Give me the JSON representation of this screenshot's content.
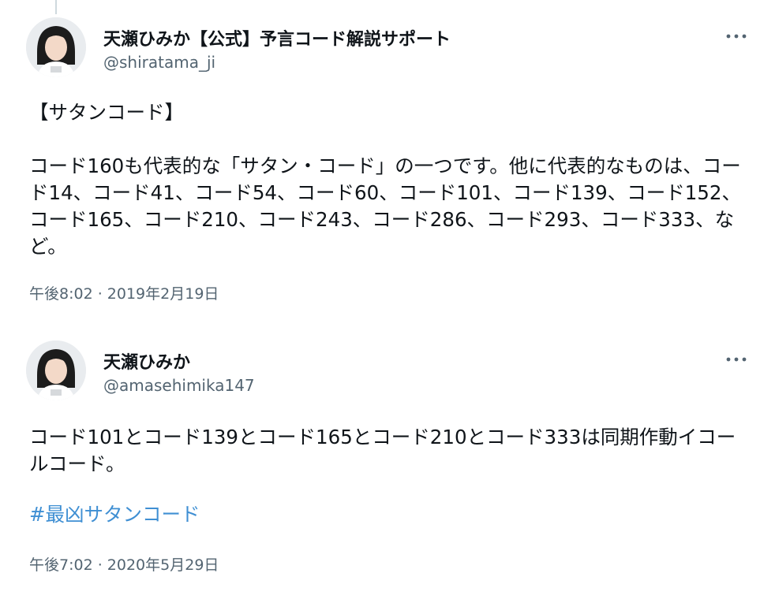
{
  "tweets": [
    {
      "name": "天瀬ひみか【公式】予言コード解説サポート",
      "handle": "@shiratama_ji",
      "body": "【サタンコード】\n\nコード160も代表的な「サタン・コード」の一つです。他に代表的なものは、コード14、コード41、コード54、コード60、コード101、コード139、コード152、コード165、コード210、コード243、コード286、コード293、コード333、など。",
      "timestamp": "午後8:02 · 2019年2月19日",
      "more_icon": "more-horizontal-icon"
    },
    {
      "name": "天瀬ひみか",
      "handle": "@amasehimika147",
      "body": "コード101とコード139とコード165とコード210とコード333は同期作動イコールコード。",
      "hashtag": "#最凶サタンコード",
      "timestamp": "午後7:02 · 2020年5月29日",
      "more_icon": "more-horizontal-icon"
    }
  ],
  "colors": {
    "text": "#0f1419",
    "secondary": "#536471",
    "link": "#3f8fd3",
    "thread_line": "#cfd9de"
  }
}
